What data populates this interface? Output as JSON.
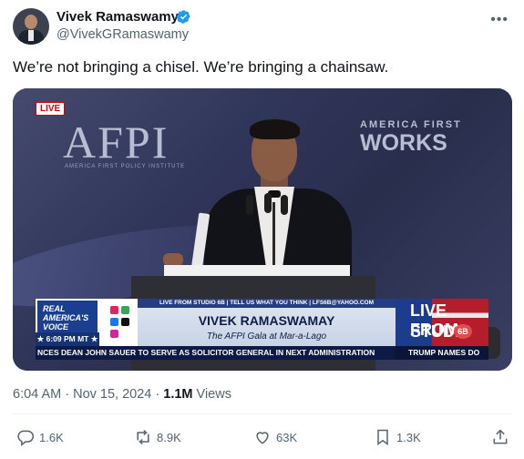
{
  "author": {
    "name": "Vivek Ramaswamy",
    "handle": "@VivekGRamaswamy",
    "verified": true
  },
  "tweet": {
    "text": "We’re not bringing a chisel. We’re bringing a chainsaw."
  },
  "video": {
    "live_badge": "LIVE",
    "backdrop_left": "AFPI",
    "backdrop_left_sub": "AMERICA FIRST POLICY INSTITUTE",
    "backdrop_right_1": "AMERICA FIRST",
    "backdrop_right_2": "WORKS",
    "lower_third": {
      "network_logo": "REAL AMERICA'S VOICE",
      "time": "6:09 PM MT",
      "top_strip": "LIVE FROM STUDIO 6B | TELL US WHAT YOU THINK | LFS6B@YAHOO.COM",
      "name": "VIVEK RAMASWAMAY",
      "event": "The AFPI Gala at Mar-a-Lago",
      "studio_line1": "LIVE FROM",
      "studio_line2": "STUDIO",
      "studio_badge": "6B",
      "ticker": "NCES DEAN JOHN SAUER TO SERVE AS SOLICITOR GENERAL IN NEXT ADMINISTRATION",
      "ticker_right": "TRUMP NAMES DO"
    }
  },
  "meta": {
    "time": "6:04 AM",
    "date": "Nov 15, 2024",
    "views_count": "1.1M",
    "views_label": "Views"
  },
  "actions": {
    "reply_count": "1.6K",
    "repost_count": "8.9K",
    "like_count": "63K",
    "bookmark_count": "1.3K"
  },
  "colors": {
    "verified_blue": "#1d9bf0",
    "muted_text": "#536471",
    "ticker_navy": "#0d1a45"
  }
}
